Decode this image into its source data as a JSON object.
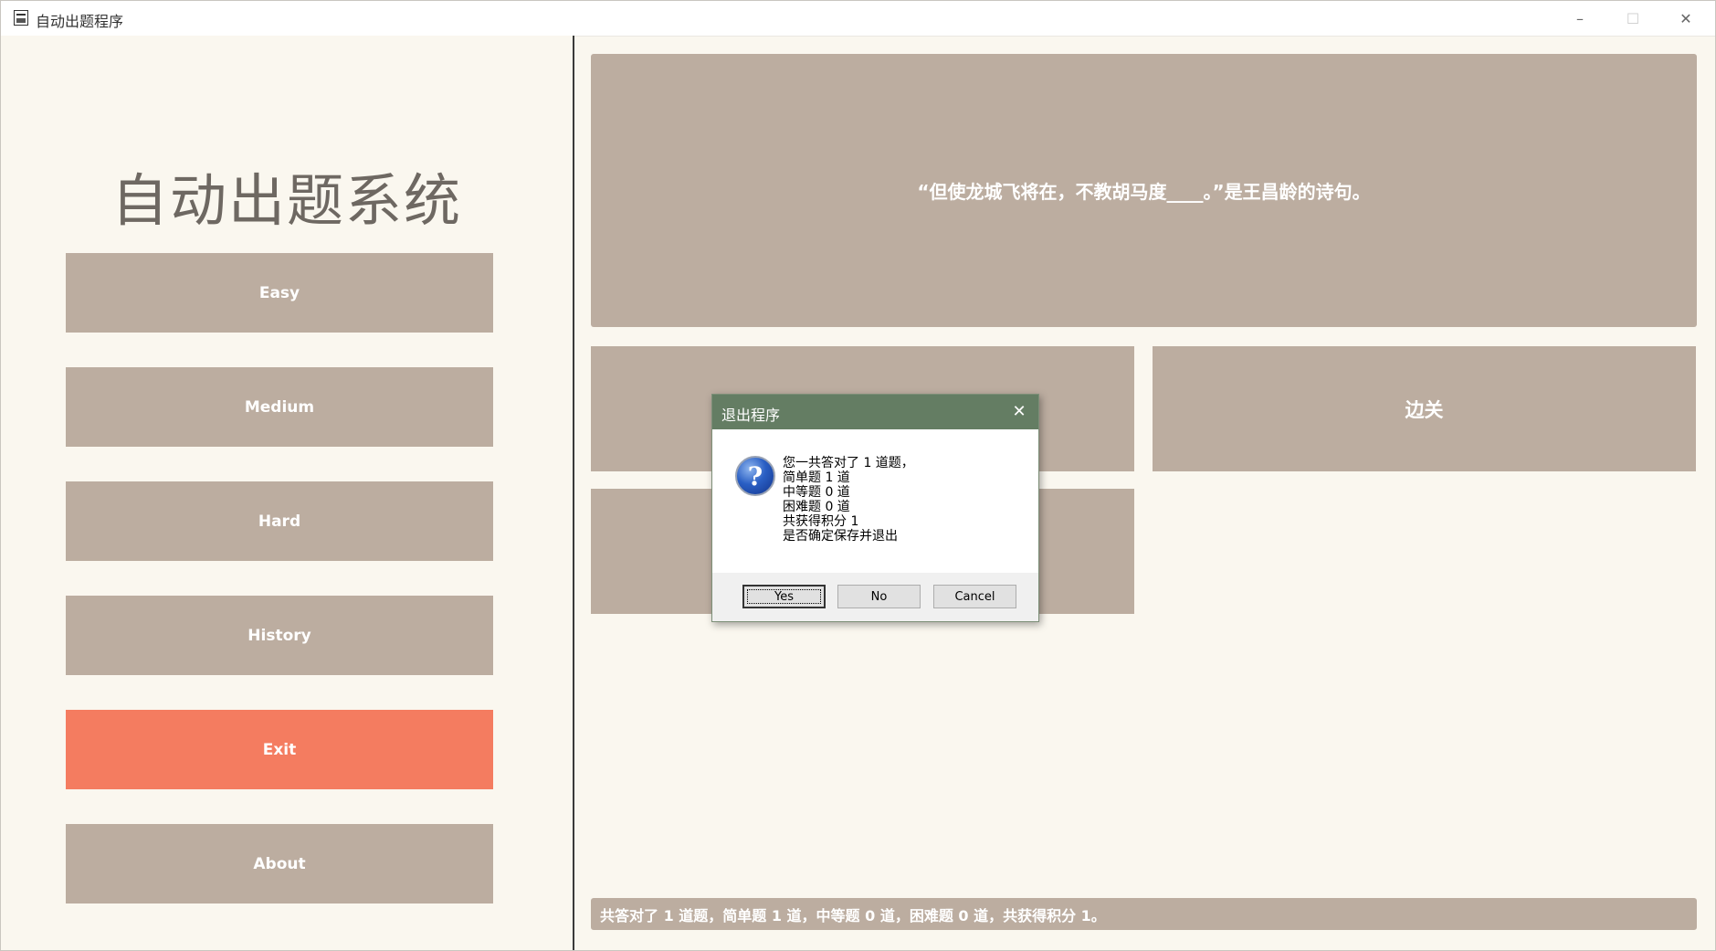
{
  "window": {
    "title": "自动出题程序",
    "min_glyph": "–",
    "max_glyph": "☐",
    "close_glyph": "✕"
  },
  "sidebar": {
    "app_title": "自动出题系统",
    "buttons": [
      {
        "label": "Easy"
      },
      {
        "label": "Medium"
      },
      {
        "label": "Hard"
      },
      {
        "label": "History"
      },
      {
        "label": "Exit"
      },
      {
        "label": "About"
      }
    ]
  },
  "main": {
    "question": "“但使龙城飞将在，不教胡马度____。”是王昌龄的诗句。",
    "options": [
      "",
      "边关",
      ""
    ],
    "status": "共答对了 1 道题，简单题 1 道，中等题 0 道，困难题 0 道，共获得积分 1。"
  },
  "dialog": {
    "title": "退出程序",
    "close_glyph": "✕",
    "icon_glyph": "?",
    "message_lines": [
      "您一共答对了 1 道题，",
      "简单题 1 道",
      "中等题 0 道",
      "困难题 0 道",
      "共获得积分 1",
      "是否确定保存并退出"
    ],
    "buttons": {
      "yes": "Yes",
      "no": "No",
      "cancel": "Cancel"
    }
  },
  "colors": {
    "panel_button": "#bcada0",
    "exit_button": "#f47c60",
    "dialog_titlebar": "#647d63",
    "background": "#faf7ef"
  }
}
